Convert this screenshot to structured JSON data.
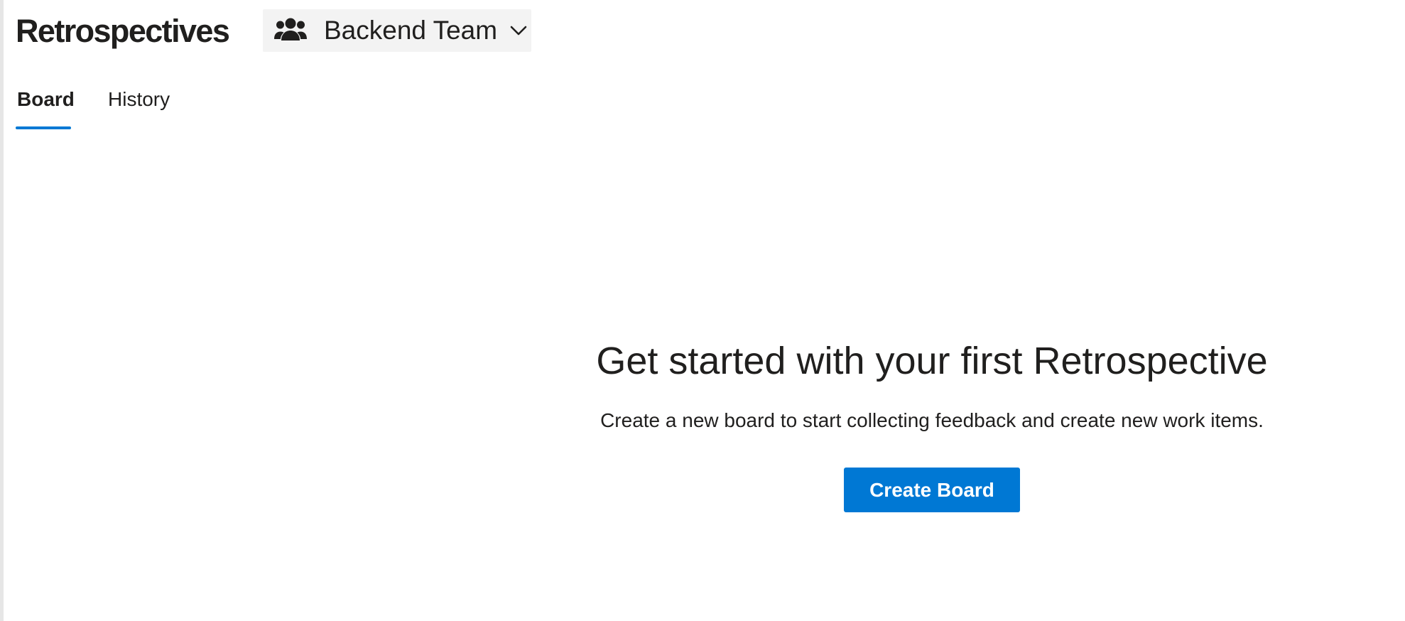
{
  "app": {
    "title": "Retrospectives"
  },
  "team_picker": {
    "label": "Backend Team",
    "icon": "team-icon",
    "dropdown_icon": "chevron-down-icon"
  },
  "tabs": [
    {
      "label": "Board",
      "active": true
    },
    {
      "label": "History",
      "active": false
    }
  ],
  "empty_state": {
    "heading": "Get started with your first Retrospective",
    "description": "Create a new board to start collecting feedback and create new work items.",
    "button_label": "Create Board"
  },
  "colors": {
    "accent": "#0078d4",
    "text": "#201f1e",
    "picker_background": "#f3f3f3"
  }
}
